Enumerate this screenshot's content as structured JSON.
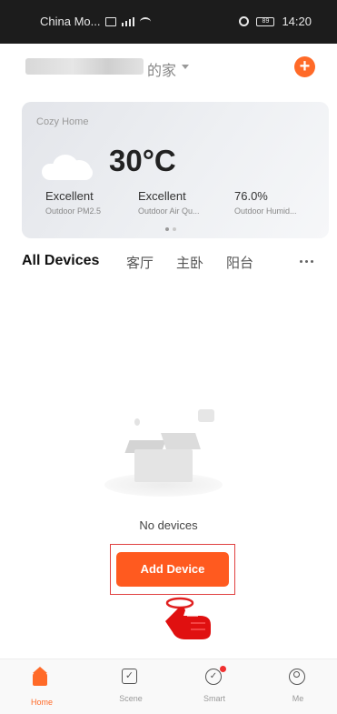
{
  "status_bar": {
    "carrier": "China Mo...",
    "time": "14:20",
    "battery": "89"
  },
  "header": {
    "home_name_suffix": "的家",
    "add_button_label": "+"
  },
  "weather": {
    "title": "Cozy Home",
    "temperature": "30°C",
    "icon": "cloud-icon",
    "stats": [
      {
        "value": "Excellent",
        "label": "Outdoor PM2.5"
      },
      {
        "value": "Excellent",
        "label": "Outdoor Air Qu..."
      },
      {
        "value": "76.0%",
        "label": "Outdoor Humid..."
      }
    ]
  },
  "tabs": [
    {
      "label": "All Devices",
      "active": true
    },
    {
      "label": "客厅"
    },
    {
      "label": "主卧"
    },
    {
      "label": "阳台"
    }
  ],
  "empty_state": {
    "message": "No devices",
    "add_device_label": "Add Device"
  },
  "bottom_nav": [
    {
      "label": "Home",
      "icon": "home-icon",
      "active": true
    },
    {
      "label": "Scene",
      "icon": "scene-icon"
    },
    {
      "label": "Smart",
      "icon": "smart-icon"
    },
    {
      "label": "Me",
      "icon": "me-icon"
    }
  ],
  "colors": {
    "accent": "#ff6a28",
    "add_device_button": "#ff5a1f",
    "highlight_frame": "#e04040"
  }
}
